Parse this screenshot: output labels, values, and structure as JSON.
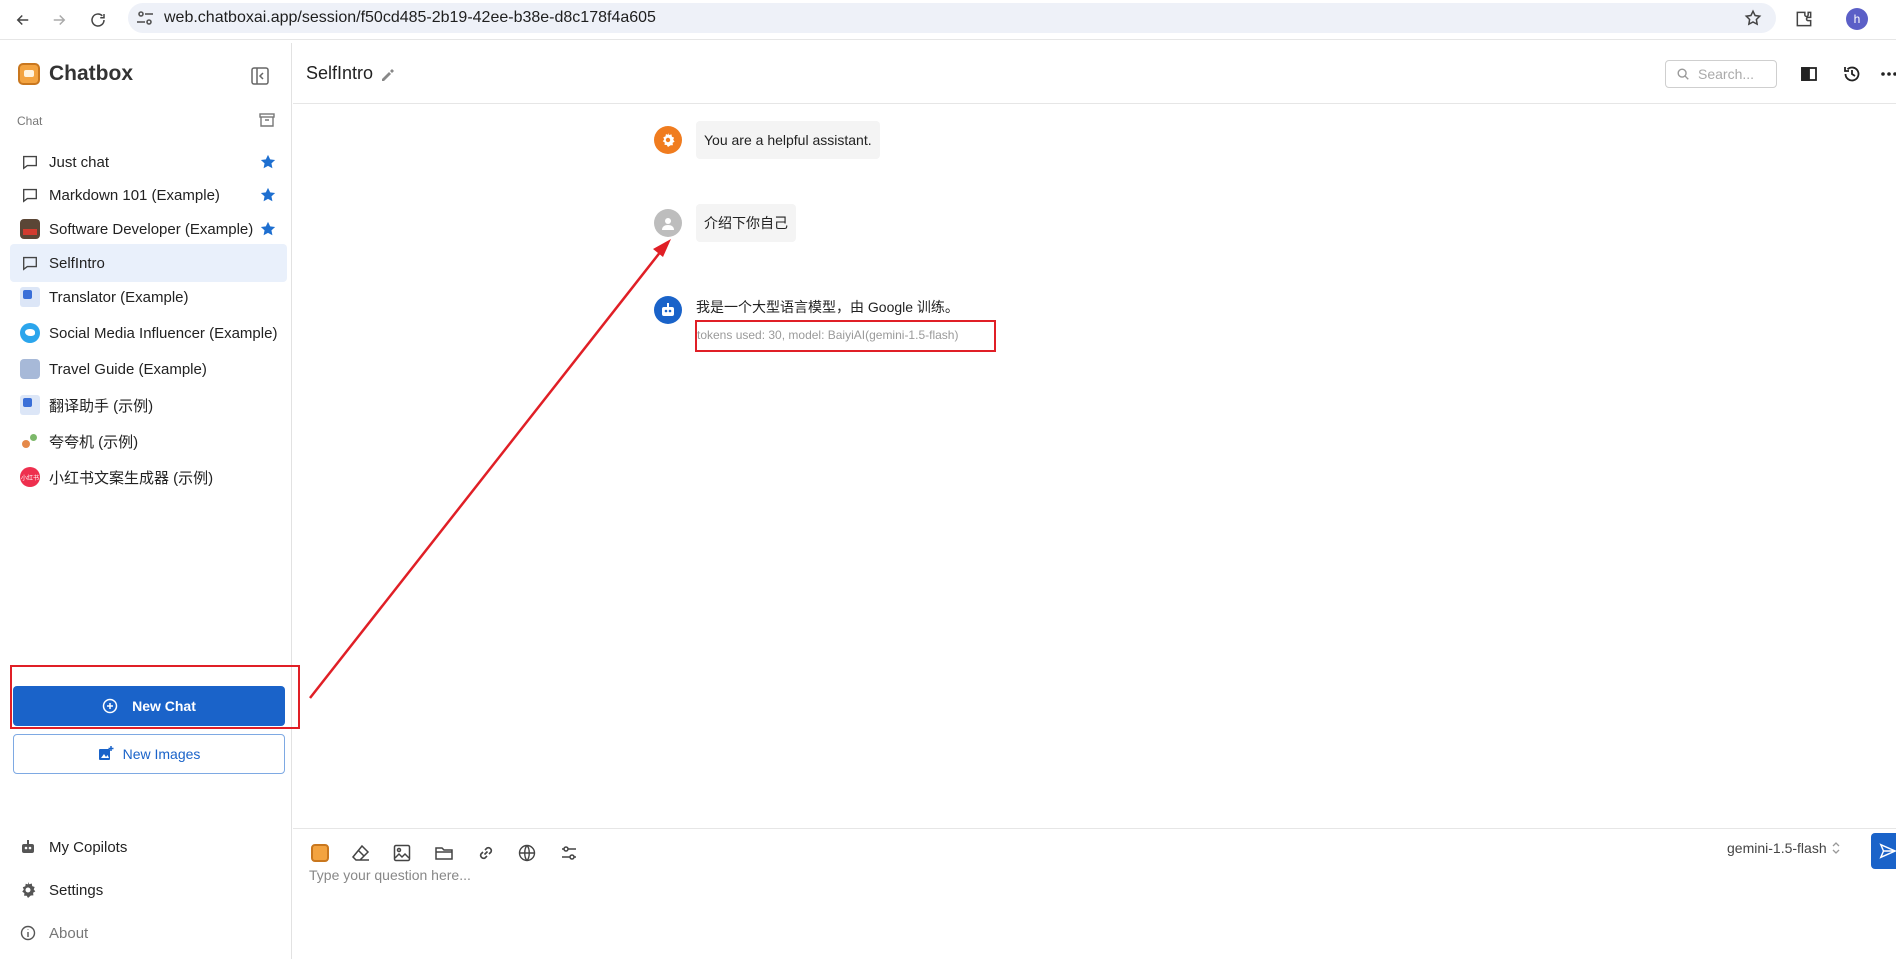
{
  "browser": {
    "url": "web.chatboxai.app/session/f50cd485-2b19-42ee-b38e-d8c178f4a605",
    "profile_initial": "h"
  },
  "sidebar": {
    "app_name": "Chatbox",
    "section_label": "Chat",
    "items": [
      {
        "label": "Just chat",
        "icon": "chat-bubble-icon",
        "starred": true,
        "active": false
      },
      {
        "label": "Markdown 101 (Example)",
        "icon": "chat-bubble-icon",
        "starred": true,
        "active": false
      },
      {
        "label": "Software Developer (Example)",
        "icon": "developer-avatar",
        "starred": true,
        "active": false
      },
      {
        "label": "SelfIntro",
        "icon": "chat-bubble-icon",
        "starred": false,
        "active": true
      },
      {
        "label": "Translator (Example)",
        "icon": "translator-avatar",
        "starred": false,
        "active": false
      },
      {
        "label": "Social Media Influencer (Example)",
        "icon": "twitter-avatar",
        "starred": false,
        "active": false
      },
      {
        "label": "Travel Guide (Example)",
        "icon": "travel-avatar",
        "starred": false,
        "active": false
      },
      {
        "label": "翻译助手 (示例)",
        "icon": "translator-avatar",
        "starred": false,
        "active": false
      },
      {
        "label": "夸夸机 (示例)",
        "icon": "praise-avatar",
        "starred": false,
        "active": false
      },
      {
        "label": "小红书文案生成器 (示例)",
        "icon": "xiaohongshu-avatar",
        "starred": false,
        "active": false
      }
    ],
    "xiaohongshu_avatar_text": "小红书",
    "new_chat_label": "New Chat",
    "new_images_label": "New Images",
    "bottom": {
      "copilots": "My Copilots",
      "settings": "Settings",
      "about": "About"
    }
  },
  "header": {
    "title": "SelfIntro",
    "search_placeholder": "Search..."
  },
  "messages": [
    {
      "role": "system",
      "text": "You are a helpful assistant."
    },
    {
      "role": "user",
      "text": "介绍下你自己"
    },
    {
      "role": "assistant",
      "text": "我是一个大型语言模型，由 Google 训练。",
      "meta": "tokens used: 30, model: BaiyiAI(gemini-1.5-flash)"
    }
  ],
  "composer": {
    "placeholder": "Type your question here...",
    "model": "gemini-1.5-flash"
  },
  "colors": {
    "accent": "#1a63c9",
    "annotation": "#e01f26",
    "system_avatar": "#f07c1f",
    "user_avatar": "#bdbdbd",
    "assistant_avatar": "#1a63c9",
    "active_item_bg": "#e9f0fb",
    "star": "#1e6fd0"
  }
}
